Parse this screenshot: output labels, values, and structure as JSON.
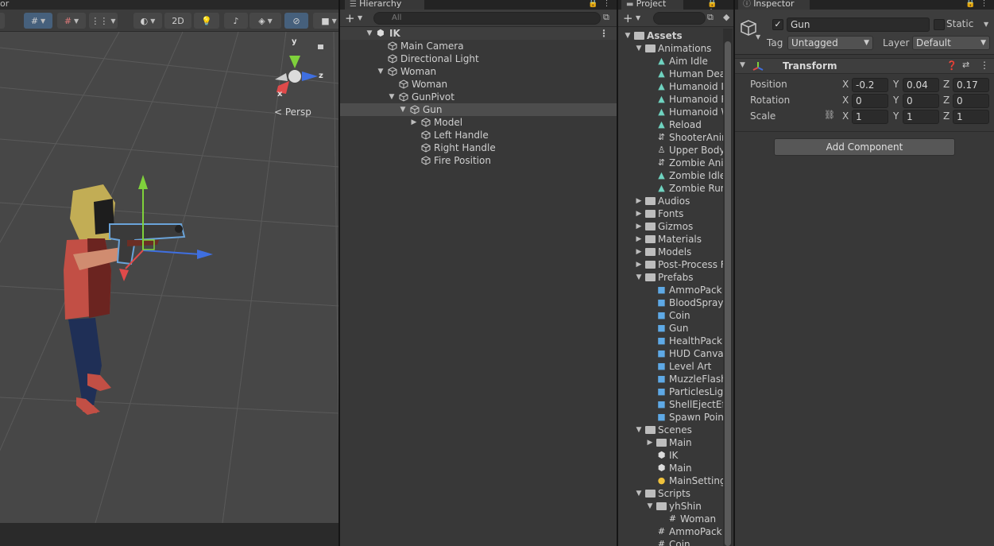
{
  "scene": {
    "tab_label": "or",
    "toolbar": {
      "mode_2d_label": "2D"
    },
    "gizmo": {
      "y_label": "y",
      "x_label": "x",
      "z_label": "z",
      "persp_label": "< Persp"
    }
  },
  "hierarchy": {
    "tab_label": "Hierarchy",
    "search_placeholder": "All",
    "rows": [
      {
        "label": "IK",
        "depth": 0,
        "fold": "▼",
        "kind": "scene"
      },
      {
        "label": "Main Camera",
        "depth": 1,
        "fold": "",
        "kind": "object"
      },
      {
        "label": "Directional Light",
        "depth": 1,
        "fold": "",
        "kind": "object"
      },
      {
        "label": "Woman",
        "depth": 1,
        "fold": "▼",
        "kind": "object"
      },
      {
        "label": "Woman",
        "depth": 2,
        "fold": "",
        "kind": "object"
      },
      {
        "label": "GunPivot",
        "depth": 2,
        "fold": "▼",
        "kind": "object"
      },
      {
        "label": "Gun",
        "depth": 3,
        "fold": "▼",
        "kind": "object",
        "selected": true
      },
      {
        "label": "Model",
        "depth": 4,
        "fold": "▶",
        "kind": "object"
      },
      {
        "label": "Left Handle",
        "depth": 4,
        "fold": "",
        "kind": "object"
      },
      {
        "label": "Right Handle",
        "depth": 4,
        "fold": "",
        "kind": "object"
      },
      {
        "label": "Fire Position",
        "depth": 4,
        "fold": "",
        "kind": "object"
      }
    ]
  },
  "project": {
    "tab_label": "Project",
    "items": [
      {
        "label": "Assets",
        "depth": 0,
        "fold": "▼",
        "icon": "folder"
      },
      {
        "label": "Animations",
        "depth": 1,
        "fold": "▼",
        "icon": "folder-open"
      },
      {
        "label": "Aim Idle",
        "depth": 2,
        "fold": "",
        "icon": "anim"
      },
      {
        "label": "Human Deat",
        "depth": 2,
        "fold": "",
        "icon": "anim"
      },
      {
        "label": "Humanoid Id",
        "depth": 2,
        "fold": "",
        "icon": "anim"
      },
      {
        "label": "Humanoid R",
        "depth": 2,
        "fold": "",
        "icon": "anim"
      },
      {
        "label": "Humanoid W",
        "depth": 2,
        "fold": "",
        "icon": "anim"
      },
      {
        "label": "Reload",
        "depth": 2,
        "fold": "",
        "icon": "anim"
      },
      {
        "label": "ShooterAnim",
        "depth": 2,
        "fold": "",
        "icon": "controller"
      },
      {
        "label": "Upper Body",
        "depth": 2,
        "fold": "",
        "icon": "avatar-mask"
      },
      {
        "label": "Zombie Anin",
        "depth": 2,
        "fold": "",
        "icon": "controller"
      },
      {
        "label": "Zombie Idle",
        "depth": 2,
        "fold": "",
        "icon": "anim"
      },
      {
        "label": "Zombie Run",
        "depth": 2,
        "fold": "",
        "icon": "anim"
      },
      {
        "label": "Audios",
        "depth": 1,
        "fold": "▶",
        "icon": "folder"
      },
      {
        "label": "Fonts",
        "depth": 1,
        "fold": "▶",
        "icon": "folder"
      },
      {
        "label": "Gizmos",
        "depth": 1,
        "fold": "▶",
        "icon": "folder"
      },
      {
        "label": "Materials",
        "depth": 1,
        "fold": "▶",
        "icon": "folder"
      },
      {
        "label": "Models",
        "depth": 1,
        "fold": "▶",
        "icon": "folder"
      },
      {
        "label": "Post-Process F",
        "depth": 1,
        "fold": "▶",
        "icon": "folder"
      },
      {
        "label": "Prefabs",
        "depth": 1,
        "fold": "▼",
        "icon": "folder-open"
      },
      {
        "label": "AmmoPack",
        "depth": 2,
        "fold": "",
        "icon": "prefab"
      },
      {
        "label": "BloodSprayE",
        "depth": 2,
        "fold": "",
        "icon": "prefab"
      },
      {
        "label": "Coin",
        "depth": 2,
        "fold": "",
        "icon": "prefab"
      },
      {
        "label": "Gun",
        "depth": 2,
        "fold": "",
        "icon": "prefab"
      },
      {
        "label": "HealthPack",
        "depth": 2,
        "fold": "",
        "icon": "prefab"
      },
      {
        "label": "HUD Canvas",
        "depth": 2,
        "fold": "",
        "icon": "prefab"
      },
      {
        "label": "Level Art",
        "depth": 2,
        "fold": "",
        "icon": "prefab"
      },
      {
        "label": "MuzzleFlash",
        "depth": 2,
        "fold": "",
        "icon": "prefab"
      },
      {
        "label": "ParticlesLigh",
        "depth": 2,
        "fold": "",
        "icon": "prefab"
      },
      {
        "label": "ShellEjectEff",
        "depth": 2,
        "fold": "",
        "icon": "prefab"
      },
      {
        "label": "Spawn Point",
        "depth": 2,
        "fold": "",
        "icon": "prefab"
      },
      {
        "label": "Scenes",
        "depth": 1,
        "fold": "▼",
        "icon": "folder-open"
      },
      {
        "label": "Main",
        "depth": 2,
        "fold": "▶",
        "icon": "folder"
      },
      {
        "label": "IK",
        "depth": 2,
        "fold": "",
        "icon": "unity-scene"
      },
      {
        "label": "Main",
        "depth": 2,
        "fold": "",
        "icon": "unity-scene"
      },
      {
        "label": "MainSetting",
        "depth": 2,
        "fold": "",
        "icon": "lighting"
      },
      {
        "label": "Scripts",
        "depth": 1,
        "fold": "▼",
        "icon": "folder-open"
      },
      {
        "label": "yhShin",
        "depth": 2,
        "fold": "▼",
        "icon": "folder-open"
      },
      {
        "label": "Woman",
        "depth": 3,
        "fold": "",
        "icon": "script"
      },
      {
        "label": "AmmoPack",
        "depth": 2,
        "fold": "",
        "icon": "script"
      },
      {
        "label": "Coin",
        "depth": 2,
        "fold": "",
        "icon": "script"
      }
    ]
  },
  "inspector": {
    "tab_label": "Inspector",
    "object_name": "Gun",
    "active_checkmark": "✓",
    "static_label": "Static",
    "tag_label": "Tag",
    "tag_value": "Untagged",
    "layer_label": "Layer",
    "layer_value": "Default",
    "transform": {
      "title": "Transform",
      "rows": [
        {
          "label": "Position",
          "x": "-0.2",
          "y": "0.04",
          "z": "0.17"
        },
        {
          "label": "Rotation",
          "x": "0",
          "y": "0",
          "z": "0"
        },
        {
          "label": "Scale",
          "x": "1",
          "y": "1",
          "z": "1"
        }
      ]
    },
    "add_component_label": "Add Component"
  },
  "colors": {
    "prefab_blue": "#5ea9e6",
    "anim_teal": "#6fd3c0",
    "gizmo_green": "#7fd13b",
    "gizmo_red": "#e04a4a",
    "gizmo_blue": "#3f6fe0",
    "selection_outline": "#6aa3d9"
  }
}
